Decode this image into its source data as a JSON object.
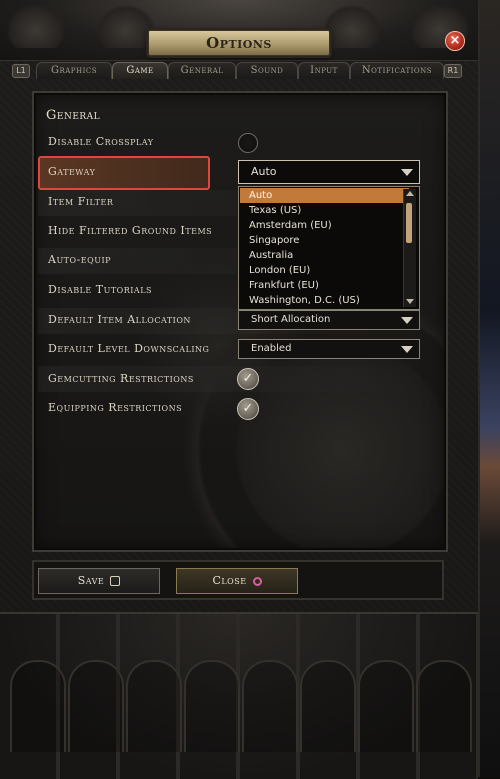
{
  "window": {
    "title": "Options",
    "close_glyph": "×"
  },
  "tabs": {
    "left_shoulder": "L1",
    "right_shoulder": "R1",
    "items": [
      {
        "label": "Graphics"
      },
      {
        "label": "Game"
      },
      {
        "label": "General"
      },
      {
        "label": "Sound"
      },
      {
        "label": "Input"
      },
      {
        "label": "Notifications"
      }
    ],
    "active": "Game"
  },
  "section": {
    "heading": "General"
  },
  "settings": [
    {
      "label": "Disable Crossplay",
      "control": "radio",
      "checked": false
    },
    {
      "label": "Gateway",
      "control": "select",
      "value": "Auto",
      "highlighted": true
    },
    {
      "label": "Item Filter",
      "control": "select"
    },
    {
      "label": "Hide Filtered Ground Items",
      "control": "select"
    },
    {
      "label": "Auto-equip",
      "control": "select"
    },
    {
      "label": "Disable Tutorials",
      "control": "select"
    },
    {
      "label": "Default Item Allocation",
      "control": "select",
      "value": "Short Allocation"
    },
    {
      "label": "Default Level Downscaling",
      "control": "select",
      "value": "Enabled"
    },
    {
      "label": "Gemcutting Restrictions",
      "control": "checkbox",
      "checked": true
    },
    {
      "label": "Equipping Restrictions",
      "control": "checkbox",
      "checked": true
    }
  ],
  "gateway_dropdown": {
    "options": [
      "Auto",
      "Texas (US)",
      "Amsterdam (EU)",
      "Singapore",
      "Australia",
      "London (EU)",
      "Frankfurt (EU)",
      "Washington, D.C. (US)"
    ],
    "selected_index": 0
  },
  "buttons": {
    "save": "Save",
    "close": "Close"
  },
  "icons": {
    "check": "✓",
    "save_glyph": "square-button-icon",
    "close_glyph": "circle-button-icon"
  },
  "colors": {
    "highlight_border": "#e0453e",
    "selected_option": "#c27a3a",
    "title_plate": "#d7c89c",
    "close_circle": "#d55fa0"
  }
}
